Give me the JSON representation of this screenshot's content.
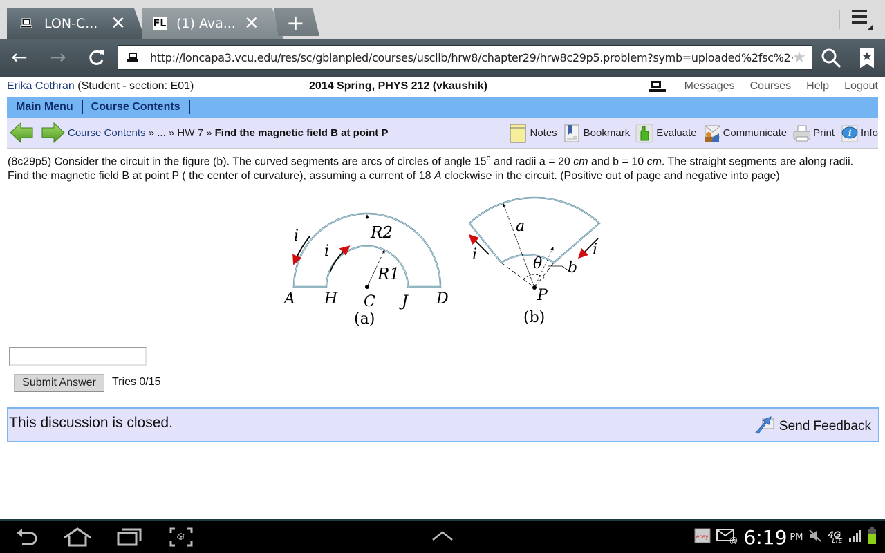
{
  "browser": {
    "tabs": [
      {
        "title": "LON-C...",
        "favicon": "computer-icon",
        "active": true
      },
      {
        "title": "(1) Ava...",
        "favicon": "FL",
        "active": false
      }
    ],
    "new_tab_label": "+",
    "close_glyph": "✕",
    "url": "http://loncapa3.vcu.edu/res/sc/gblanpied/courses/usclib/hrw8/chapter29/hrw8c29p5.problem?symb=uploaded%2fsc%2·",
    "nav": {
      "back": "←",
      "forward": "→",
      "reload": "C"
    }
  },
  "page": {
    "user": {
      "name": "Erika Cothran",
      "role": " (Student  - section: E01)"
    },
    "course_title": "2014 Spring, PHYS 212 (vkaushik)",
    "top_nav": [
      "Messages",
      "Courses",
      "Help",
      "Logout"
    ],
    "main_menu": [
      "Main Menu",
      "Course Contents"
    ],
    "breadcrumb": {
      "parts": [
        "Course Contents",
        " » ... » ",
        "HW 7",
        " » "
      ],
      "current": "Find the magnetic field B at point P"
    },
    "toolbar": [
      {
        "label": "Notes",
        "icon": "notes-icon"
      },
      {
        "label": "Bookmark",
        "icon": "bookmark-icon"
      },
      {
        "label": "Evaluate",
        "icon": "thumbs-up-icon"
      },
      {
        "label": "Communicate",
        "icon": "communicate-icon"
      },
      {
        "label": "Print",
        "icon": "printer-icon"
      },
      {
        "label": "Info",
        "icon": "info-icon"
      }
    ],
    "question": {
      "id": "(8c29p5)",
      "text1": " Consider the circuit in the figure (b). The curved segments are arcs of circles of angle 15",
      "degree": "o",
      "text2": " and radii a = 20 ",
      "unit1": "cm",
      "text3": " and b = 10 ",
      "unit2": "cm",
      "text4": ". The straight segments are along radii. Find the magnetic field B at point P ( the center of curvature), assuming a current of 18 ",
      "unit3": "A",
      "text5": " clockwise in the circuit. (Positive out of page and negative into page)"
    },
    "figure": {
      "a_labels": {
        "A": "A",
        "H": "H",
        "C": "C",
        "J": "J",
        "D": "D",
        "R1": "R1",
        "R2": "R2",
        "i": "i",
        "caption": "(a)"
      },
      "b_labels": {
        "a": "a",
        "b": "b",
        "theta": "θ",
        "P": "P",
        "i": "i",
        "caption": "(b)"
      }
    },
    "answer": {
      "value": "",
      "submit_label": "Submit Answer",
      "tries": "Tries 0/15"
    },
    "discussion": {
      "text": "This discussion is closed.",
      "feedback_label": "Send Feedback"
    }
  },
  "status_bar": {
    "time": "6:19",
    "ampm": "PM",
    "network": "4G",
    "network_sub": "LTE"
  },
  "colors": {
    "menu_bar": "#75b4f3",
    "crumb_bar": "#e2e2fb",
    "link": "#1a3a7a",
    "wire": "#7aa6b4",
    "arrow_red": "#d01010"
  }
}
